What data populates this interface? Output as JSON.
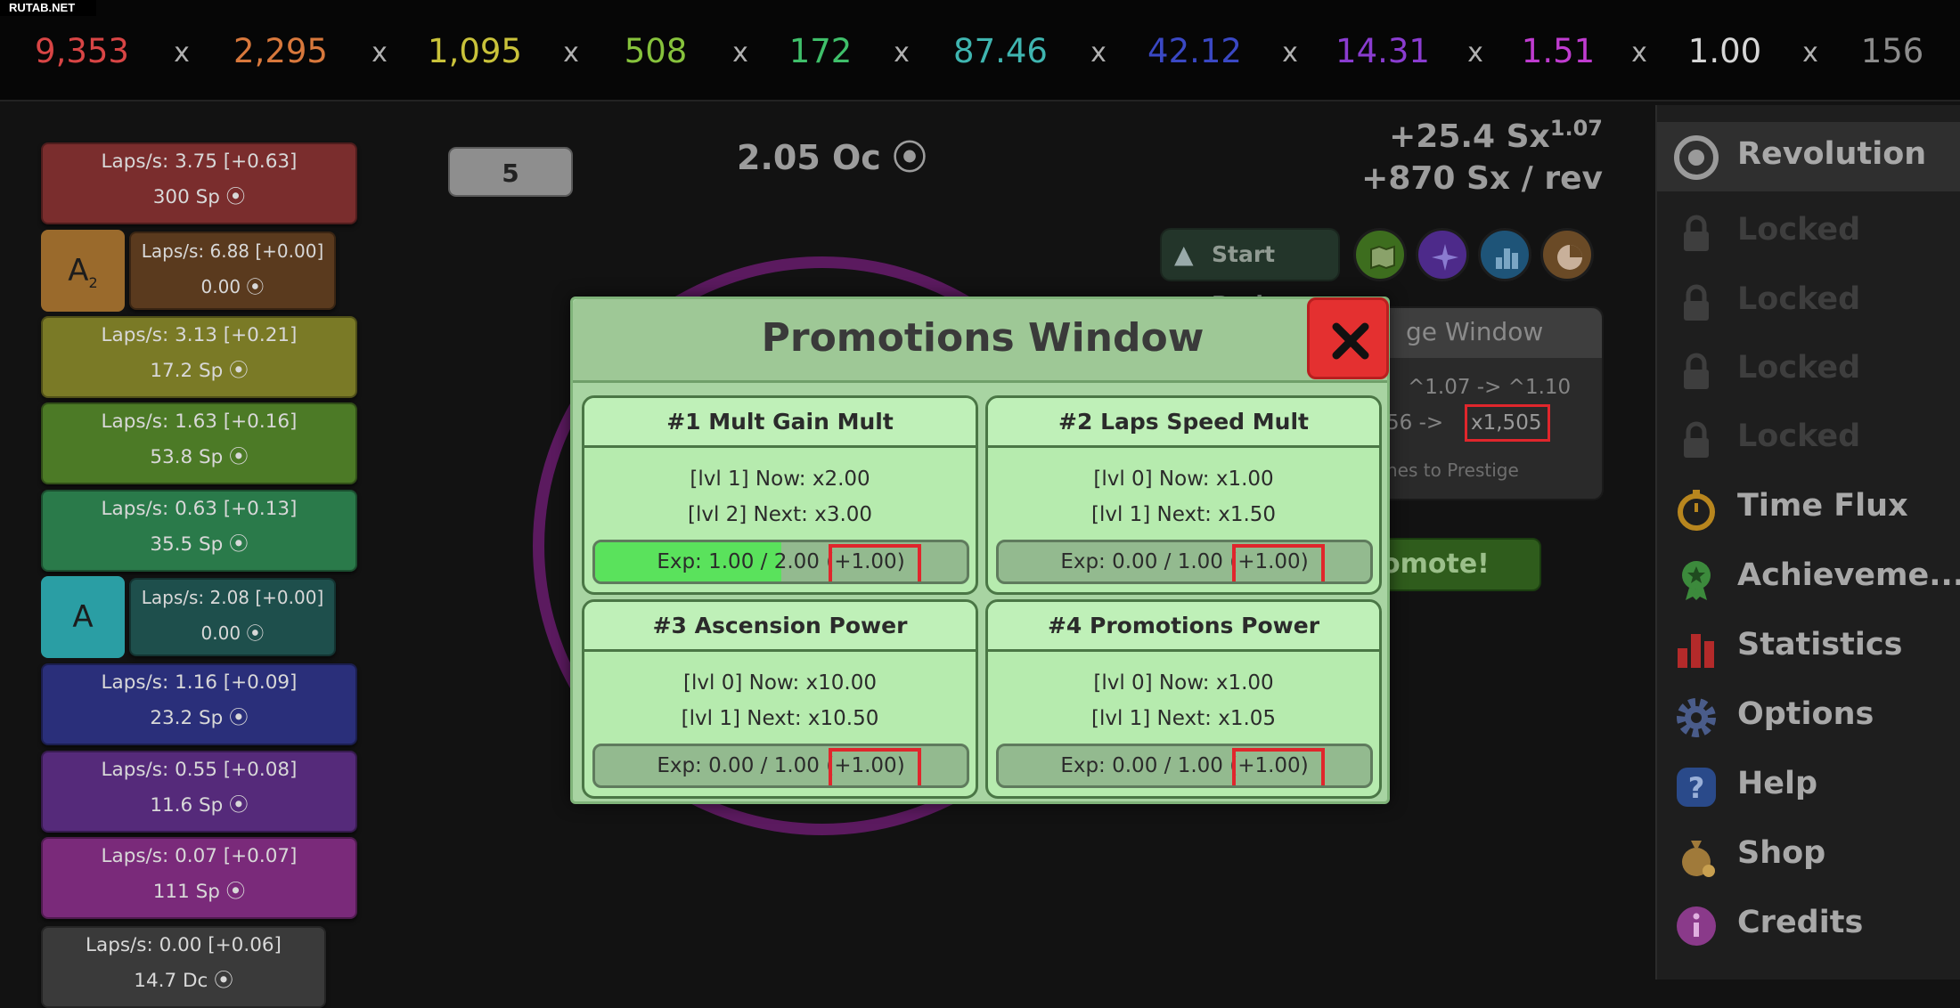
{
  "watermark": "RUTAB.NET",
  "multipliers": [
    {
      "value": "9,353",
      "color": "#d84545"
    },
    {
      "value": "2,295",
      "color": "#d8783c"
    },
    {
      "value": "1,095",
      "color": "#c9c23a"
    },
    {
      "value": "508",
      "color": "#86c23c"
    },
    {
      "value": "172",
      "color": "#3fbf6a"
    },
    {
      "value": "87.46",
      "color": "#3fb5b0"
    },
    {
      "value": "42.12",
      "color": "#3a48c4"
    },
    {
      "value": "14.31",
      "color": "#8a3cd0"
    },
    {
      "value": "1.51",
      "color": "#c03cd0"
    },
    {
      "value": "1.00",
      "color": "#d6d6d6"
    },
    {
      "value": "156",
      "color": "#8c8c8c"
    }
  ],
  "separator": "x",
  "laps": [
    {
      "rate": "Laps/s: 3.75 [+0.63]",
      "cost": "300 Sp ⦿",
      "color": "#7a2d2d"
    },
    {
      "rate": "Laps/s: 6.88 [+0.00]",
      "cost": "0.00 ⦿",
      "color": "#5a3a1e"
    },
    {
      "rate": "Laps/s: 3.13 [+0.21]",
      "cost": "17.2 Sp ⦿",
      "color": "#7a7a26"
    },
    {
      "rate": "Laps/s: 1.63 [+0.16]",
      "cost": "53.8 Sp ⦿",
      "color": "#4c7a26"
    },
    {
      "rate": "Laps/s: 0.63 [+0.13]",
      "cost": "35.5 Sp ⦿",
      "color": "#2a7a4a"
    },
    {
      "rate": "Laps/s: 2.08 [+0.00]",
      "cost": "0.00 ⦿",
      "color": "#1e4f4c"
    },
    {
      "rate": "Laps/s: 1.16 [+0.09]",
      "cost": "23.2 Sp ⦿",
      "color": "#2a2f7a"
    },
    {
      "rate": "Laps/s: 0.55 [+0.08]",
      "cost": "11.6 Sp ⦿",
      "color": "#552a7a"
    },
    {
      "rate": "Laps/s: 0.07 [+0.07]",
      "cost": "111 Sp ⦿",
      "color": "#7a2a7a"
    },
    {
      "rate": "Laps/s: 0.00 [+0.06]",
      "cost": "14.7 Dc ⦿",
      "color": "#3a3a3a"
    }
  ],
  "tags": {
    "a2": "A",
    "a2_sub": "2",
    "a": "A"
  },
  "counter": "5",
  "currency": "2.05 Oc ⦿",
  "gain": {
    "line1": "+25.4 Sx",
    "line1_exp": "1.07",
    "line2": "+870 Sx / rev"
  },
  "start_pack": "Start Pack",
  "prestige": {
    "title": "ge Window",
    "line1": "^1.07 -> ^1.10",
    "line2": "56 ->",
    "line2_value": "x1,505",
    "line3": "nes to Prestige"
  },
  "promote_label": "omote!",
  "sidebar": [
    {
      "label": "Revolution",
      "color": "#a8a8a8",
      "active": true
    },
    {
      "label": "Locked",
      "color": "#3e3e3e"
    },
    {
      "label": "Locked",
      "color": "#3e3e3e"
    },
    {
      "label": "Locked",
      "color": "#3e3e3e"
    },
    {
      "label": "Locked",
      "color": "#3e3e3e"
    },
    {
      "label": "Time Flux",
      "color": "#a8a8a8"
    },
    {
      "label": "Achieveme...",
      "color": "#a8a8a8"
    },
    {
      "label": "Statistics",
      "color": "#a8a8a8"
    },
    {
      "label": "Options",
      "color": "#a8a8a8"
    },
    {
      "label": "Help",
      "color": "#a8a8a8"
    },
    {
      "label": "Shop",
      "color": "#a8a8a8"
    },
    {
      "label": "Credits",
      "color": "#a8a8a8"
    }
  ],
  "modal": {
    "title": "Promotions Window",
    "cards": [
      {
        "title": "#1 Mult Gain Mult",
        "now": "[lvl 1] Now: x2.00",
        "next": "[lvl 2] Next: x3.00",
        "exp": "Exp: 1.00 / 2.00",
        "gain": "(+1.00)",
        "progress": 0.5
      },
      {
        "title": "#2 Laps Speed Mult",
        "now": "[lvl 0] Now: x1.00",
        "next": "[lvl 1] Next: x1.50",
        "exp": "Exp: 0.00 / 1.00",
        "gain": "(+1.00)",
        "progress": 0
      },
      {
        "title": "#3 Ascension Power",
        "now": "[lvl 0] Now: x10.00",
        "next": "[lvl 1] Next: x10.50",
        "exp": "Exp: 0.00 / 1.00",
        "gain": "(+1.00)",
        "progress": 0
      },
      {
        "title": "#4 Promotions Power",
        "now": "[lvl 0] Now: x1.00",
        "next": "[lvl 1] Next: x1.05",
        "exp": "Exp: 0.00 / 1.00",
        "gain": "(+1.00)",
        "progress": 0
      }
    ]
  }
}
